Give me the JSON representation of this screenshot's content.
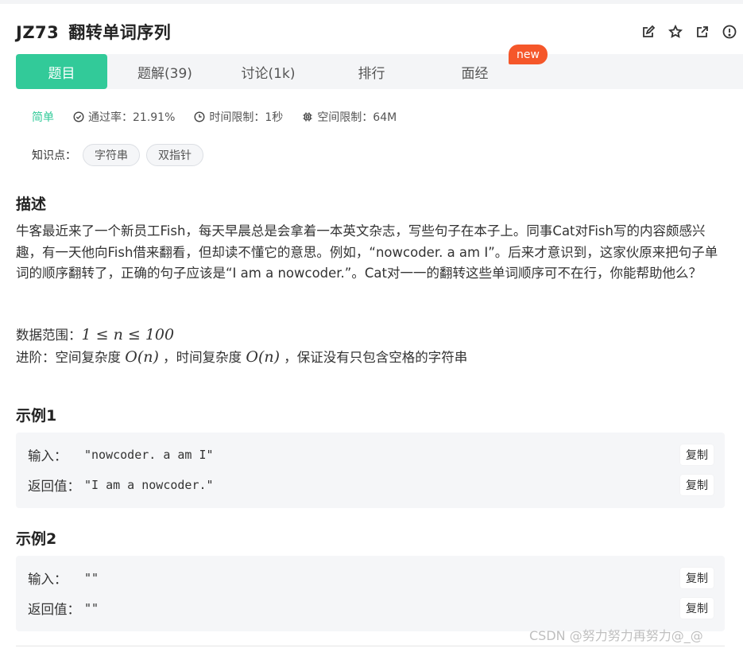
{
  "header": {
    "code": "JZ73",
    "title": "翻转单词序列"
  },
  "tabs": [
    {
      "label": "题目"
    },
    {
      "label": "题解(39)"
    },
    {
      "label": "讨论(1k)"
    },
    {
      "label": "排行"
    },
    {
      "label": "面经"
    }
  ],
  "badge_new": "new",
  "meta": {
    "difficulty": "简单",
    "pass_rate": "通过率：21.91%",
    "time_limit": "时间限制：1秒",
    "space_limit": "空间限制：64M"
  },
  "knowledge": {
    "label": "知识点：",
    "tags": [
      "字符串",
      "双指针"
    ]
  },
  "description": {
    "title": "描述",
    "text": "牛客最近来了一个新员工Fish，每天早晨总是会拿着一本英文杂志，写些句子在本子上。同事Cat对Fish写的内容颇感兴趣，有一天他向Fish借来翻看，但却读不懂它的意思。例如，“nowcoder. a am I”。后来才意识到，这家伙原来把句子单词的顺序翻转了，正确的句子应该是“I am a nowcoder.”。Cat对一一的翻转这些单词顺序可不在行，你能帮助他么？",
    "range_label": "数据范围：",
    "range_math": "1 ≤ n ≤ 100",
    "advanced_label": "进阶：空间复杂度",
    "advanced_space": "O(n)",
    "advanced_mid": "，时间复杂度",
    "advanced_time": "O(n)",
    "advanced_tail": "，保证没有只包含空格的字符串"
  },
  "examples": [
    {
      "title": "示例1",
      "input_label": "输入：",
      "input": "\"nowcoder. a am I\"",
      "output_label": "返回值：",
      "output": "\"I am a nowcoder.\"",
      "copy": "复制"
    },
    {
      "title": "示例2",
      "input_label": "输入：",
      "input": "\"\"",
      "output_label": "返回值：",
      "output": "\"\"",
      "copy": "复制"
    }
  ],
  "watermark": "CSDN @努力努力再努力@_@",
  "icons": {
    "edit": "edit-icon",
    "star": "star-icon",
    "share": "share-icon",
    "report": "alert-icon",
    "pass": "check-circle-icon",
    "time": "clock-icon",
    "space": "chip-icon"
  },
  "colors": {
    "accent": "#32ca99",
    "badge": "#f5572a"
  }
}
